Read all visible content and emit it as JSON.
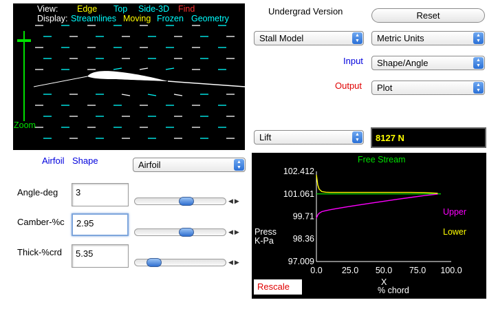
{
  "viewer": {
    "view_label": "View:",
    "view_options": [
      {
        "label": "Edge",
        "color": "#ffff00"
      },
      {
        "label": "Top",
        "color": "#00ffff"
      },
      {
        "label": "Side-3D",
        "color": "#00ffff"
      },
      {
        "label": "Find",
        "color": "#ff3030"
      }
    ],
    "display_label": "Display:",
    "display_options": [
      {
        "label": "Streamlines",
        "color": "#00ffff"
      },
      {
        "label": "Moving",
        "color": "#ffff00"
      },
      {
        "label": "Frozen",
        "color": "#00ffff"
      },
      {
        "label": "Geometry",
        "color": "#00ffff"
      }
    ],
    "zoom_label": "Zoom",
    "zoom_color": "#00e000",
    "streamline_colors": [
      "#ffffff",
      "#00ffff"
    ]
  },
  "header": {
    "version_label": "Undergrad Version",
    "reset_label": "Reset"
  },
  "controls": {
    "stall_model": "Stall Model",
    "units": "Metric Units",
    "input_label": "Input",
    "input_color": "#0000dd",
    "input_value": "Shape/Angle",
    "output_label": "Output",
    "output_color": "#e00000",
    "output_value": "Plot",
    "result_select": "Lift",
    "result_value": "8127 N"
  },
  "airfoil": {
    "title_a": "Airfoil",
    "title_b": "Shape",
    "title_color": "#0000dd",
    "shape_select": "Airfoil",
    "angle_label": "Angle-deg",
    "angle_value": "3",
    "angle_slider_level": 0.58,
    "camber_label": "Camber-%c",
    "camber_value": "2.95",
    "camber_slider_level": 0.58,
    "thick_label": "Thick-%crd",
    "thick_value": "5.35",
    "thick_slider_level": 0.16,
    "slider_steps": "◀▶"
  },
  "plot": {
    "rescale_label": "Rescale"
  },
  "chart_data": {
    "type": "line",
    "title": "Free Stream",
    "xlabel": "X",
    "xlabel2": "% chord",
    "ylabel": "Press",
    "ylabel2": "K-Pa",
    "xlim": [
      0,
      100
    ],
    "ylim": [
      97.009,
      102.412
    ],
    "x_ticks": [
      "0.0",
      "25.0",
      "50.0",
      "75.0",
      "100.0"
    ],
    "y_ticks": [
      "102.412",
      "101.061",
      "99.71",
      "98.36",
      "97.009"
    ],
    "free_stream": 101.061,
    "series": [
      {
        "name": "Upper",
        "color": "#ff00ff",
        "x": [
          0,
          1,
          2,
          4,
          7,
          10,
          15,
          20,
          30,
          40,
          50,
          60,
          70,
          80,
          90
        ],
        "y": [
          99.6,
          99.8,
          99.9,
          100.0,
          100.06,
          100.11,
          100.18,
          100.25,
          100.38,
          100.5,
          100.62,
          100.74,
          100.85,
          100.96,
          101.05
        ]
      },
      {
        "name": "Lower",
        "color": "#ffff00",
        "x": [
          0,
          1,
          2,
          4,
          7,
          10,
          15,
          20,
          30,
          40,
          50,
          60,
          70,
          80,
          90
        ],
        "y": [
          102.2,
          101.6,
          101.35,
          101.2,
          101.16,
          101.15,
          101.15,
          101.15,
          101.15,
          101.15,
          101.15,
          101.15,
          101.15,
          101.14,
          101.1
        ]
      }
    ]
  }
}
